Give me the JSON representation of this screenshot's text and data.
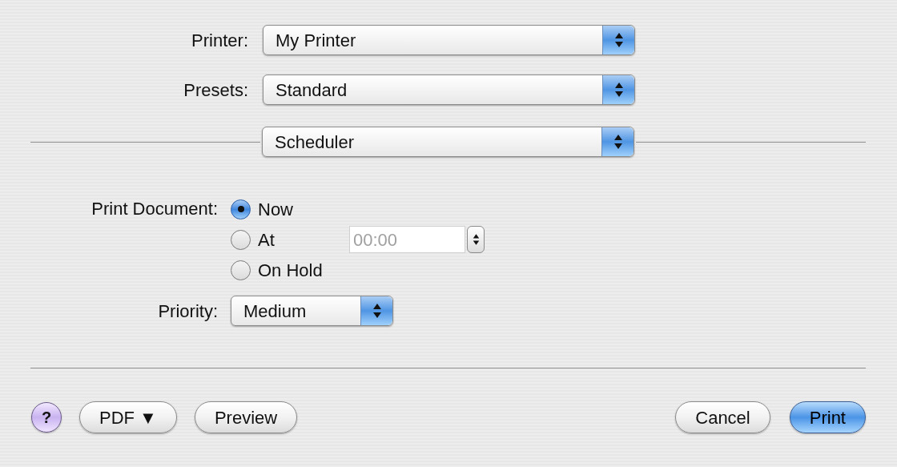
{
  "printer": {
    "label": "Printer:",
    "value": "My Printer"
  },
  "presets": {
    "label": "Presets:",
    "value": "Standard"
  },
  "panel": {
    "value": "Scheduler"
  },
  "print_document": {
    "label": "Print Document:",
    "options": [
      {
        "label": "Now",
        "selected": true
      },
      {
        "label": "At",
        "selected": false,
        "time": {
          "value": "00:00",
          "disabled": true
        }
      },
      {
        "label": "On Hold",
        "selected": false
      }
    ]
  },
  "priority": {
    "label": "Priority:",
    "value": "Medium"
  },
  "buttons": {
    "help": "?",
    "pdf": "PDF ▼",
    "preview": "Preview",
    "cancel": "Cancel",
    "print": "Print"
  }
}
